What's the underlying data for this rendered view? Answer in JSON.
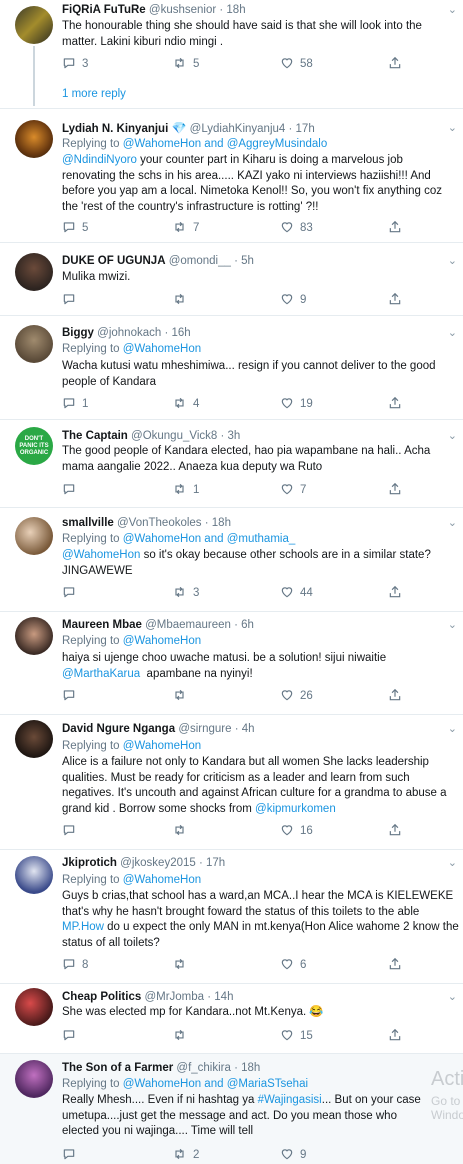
{
  "tweets": [
    {
      "name": "FiQRiA FuTuRe",
      "handle": "@kushsenior",
      "time": "· 18h",
      "text": "The honourable thing she should have said is that she will look into the matter. Lakini kiburi ndio mingi .",
      "replies": "3",
      "retweets": "5",
      "likes": "58",
      "more_replies": "1 more reply"
    },
    {
      "name": "Lydiah N. Kinyanjui",
      "handle": "@LydiahKinyanju4",
      "time": "· 17h",
      "reply_prefix": "Replying to",
      "reply_to": "@WahomeHon and @AggreyMusindalo",
      "mention": "@NdindiNyoro",
      "text": " your counter part in Kiharu is doing a marvelous job renovating the schs in his area..... KAZI yako ni interviews haziishi!!! And before you yap am a local. Nimetoka Kenol!! So, you won't fix anything coz the 'rest of the country's infrastructure is rotting' ?!!",
      "replies": "5",
      "retweets": "7",
      "likes": "83"
    },
    {
      "name": "DUKE OF UGUNJA",
      "handle": "@omondi__",
      "time": "· 5h",
      "text": "Mulika mwizi.",
      "replies": "",
      "retweets": "",
      "likes": "9"
    },
    {
      "name": "Biggy",
      "handle": "@johnokach",
      "time": "· 16h",
      "reply_prefix": "Replying to",
      "reply_to": "@WahomeHon",
      "text": "Wacha kutusi watu mheshimiwa... resign if you cannot deliver to the good people of Kandara",
      "replies": "1",
      "retweets": "4",
      "likes": "19"
    },
    {
      "name": "The Captain",
      "handle": "@Okungu_Vick8",
      "time": "· 3h",
      "avatar_text": "DON'T PANIC ITS ORGANIC",
      "text": "The good people of Kandara elected, hao pia wapambane na hali.. Acha mama aangalie 2022.. Anaeza kua deputy wa Ruto",
      "replies": "",
      "retweets": "1",
      "likes": "7"
    },
    {
      "name": "smallville",
      "handle": "@VonTheokoles",
      "time": "· 18h",
      "reply_prefix": "Replying to",
      "reply_to": "@WahomeHon and @muthamia_",
      "mention": "@WahomeHon",
      "text": " so it's okay because other schools are in a similar state? JINGAWEWE",
      "replies": "",
      "retweets": "3",
      "likes": "44"
    },
    {
      "name": "Maureen Mbae",
      "handle": "@Mbaemaureen",
      "time": "· 6h",
      "reply_prefix": "Replying to",
      "reply_to": "@WahomeHon",
      "text": "haiya si ujenge choo uwache matusi. be a solution! sijui niwaitie ",
      "mention_end": "@MarthaKarua",
      "text2": "  apambane na nyinyi!",
      "replies": "",
      "retweets": "",
      "likes": "26"
    },
    {
      "name": "David Ngure Nganga",
      "handle": "@sirngure",
      "time": "· 4h",
      "reply_prefix": "Replying to",
      "reply_to": "@WahomeHon",
      "text": "Alice is a failure not only to Kandara but all women She lacks leadership qualities. Must be ready for criticism as a leader and learn from such negatives. It's uncouth and against African culture for a grandma to abuse a grand kid . Borrow some shocks from ",
      "mention_end": "@kipmurkomen",
      "replies": "",
      "retweets": "",
      "likes": "16"
    },
    {
      "name": "Jkiprotich",
      "handle": "@jkoskey2015",
      "time": "· 17h",
      "reply_prefix": "Replying to",
      "reply_to": "@WahomeHon",
      "text_a": "Guys b crias,that school has a ward,an MCA..I hear the MCA is KIELEWEKE that's why he hasn't brought foward the status of this toilets to the able ",
      "mention_mid": "MP.How",
      "text_b": " do u expect the only MAN in mt.kenya(Hon Alice wahome 2 know the status of all toilets?",
      "replies": "8",
      "retweets": "",
      "likes": "6"
    },
    {
      "name": "Cheap Politics",
      "handle": "@MrJomba",
      "time": "· 14h",
      "text": "She was elected mp for Kandara..not Mt.Kenya. 😂",
      "replies": "",
      "retweets": "",
      "likes": "15"
    },
    {
      "name": "The Son of a Farmer",
      "handle": "@f_chikira",
      "time": "· 18h",
      "reply_prefix": "Replying to",
      "reply_to": "@WahomeHon and @MariaSTsehai",
      "text": "Really Mhesh.... Even if ni hashtag ya ",
      "mention_mid": "#Wajingasisi",
      "text_b": "... But on your case umetupa....just get the message and act. Do you mean those who elected you ni wajinga.... Time will tell",
      "replies": "",
      "retweets": "2",
      "likes": "9"
    }
  ],
  "watermark": {
    "line1": "Acti",
    "line2": "Go to",
    "line3": "Windo"
  },
  "icons": {
    "reply": "reply-icon",
    "retweet": "retweet-icon",
    "like": "heart-icon",
    "share": "share-icon",
    "more": "chevron-down-icon",
    "verified": "verified-badge-icon"
  },
  "colors": {
    "link": "#1b95e0",
    "muted": "#657786",
    "border": "#e6ecf0"
  }
}
